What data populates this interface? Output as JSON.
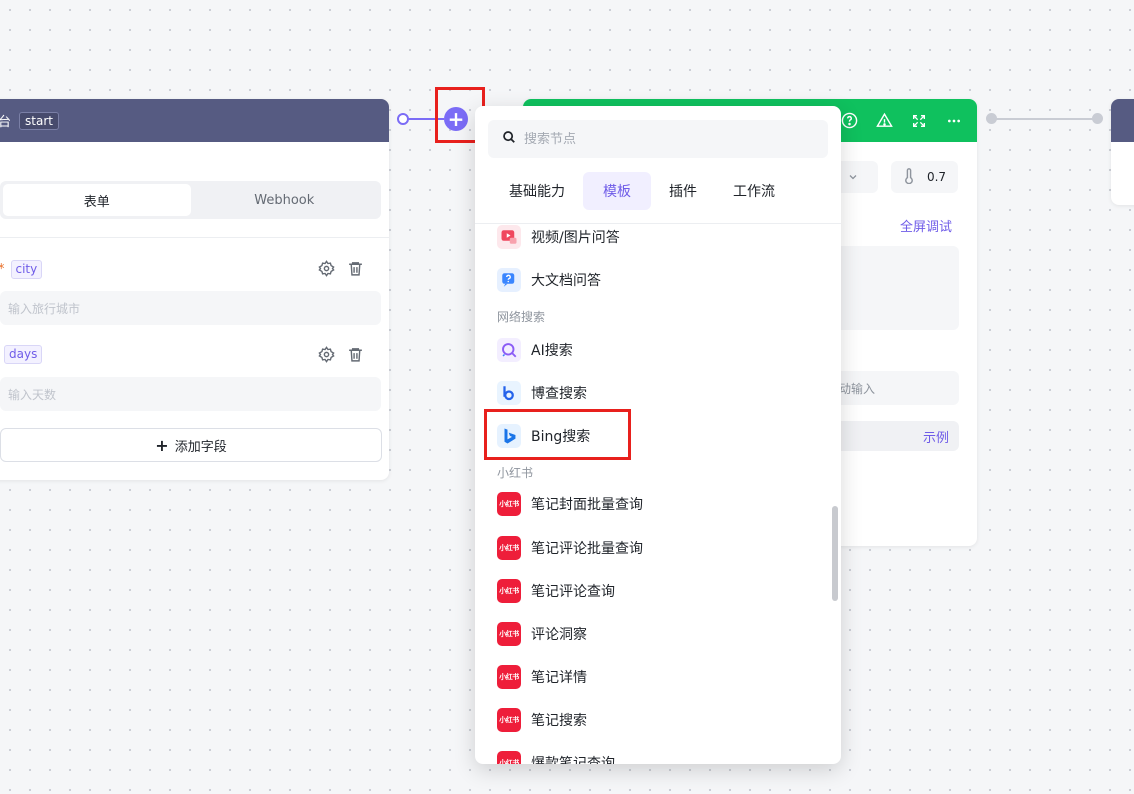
{
  "start_node": {
    "title_fragment": "台",
    "tag": "start",
    "tabs": [
      {
        "label": "表单",
        "active": true
      },
      {
        "label": "Webhook",
        "active": false
      }
    ],
    "fields": [
      {
        "required_mark": "*",
        "name": "city",
        "placeholder": "输入旅行城市"
      },
      {
        "required_mark": "",
        "name": "days",
        "placeholder": "输入天数"
      }
    ],
    "add_field_label": "添加字段"
  },
  "llm_node": {
    "temperature": "0.7",
    "full_debug_label": "全屏调试",
    "auto_input_text": "动输入",
    "example_label": "示例"
  },
  "node_picker": {
    "search_placeholder": "搜索节点",
    "tabs": [
      {
        "label": "基础能力",
        "active": false
      },
      {
        "label": "模板",
        "active": true
      },
      {
        "label": "插件",
        "active": false
      },
      {
        "label": "工作流",
        "active": false
      }
    ],
    "items": {
      "video_qa": "视频/图片问答",
      "big_doc_qa": "大文档问答",
      "group_web_search": "网络搜索",
      "ai_search": "AI搜索",
      "bocha_search": "博查搜索",
      "bing_search": "Bing搜索",
      "group_xiaohongshu": "小红书",
      "xhs_icon_text": "小红书",
      "xhs_items": [
        "笔记封面批量查询",
        "笔记评论批量查询",
        "笔记评论查询",
        "评论洞察",
        "笔记详情",
        "笔记搜索",
        "爆款笔记查询"
      ]
    }
  },
  "colors": {
    "accent": "#7b6cf6",
    "start_header": "#565b82",
    "llm_header": "#0fc15e",
    "highlight": "#e8201d",
    "xiaohongshu": "#ee1e3a"
  }
}
